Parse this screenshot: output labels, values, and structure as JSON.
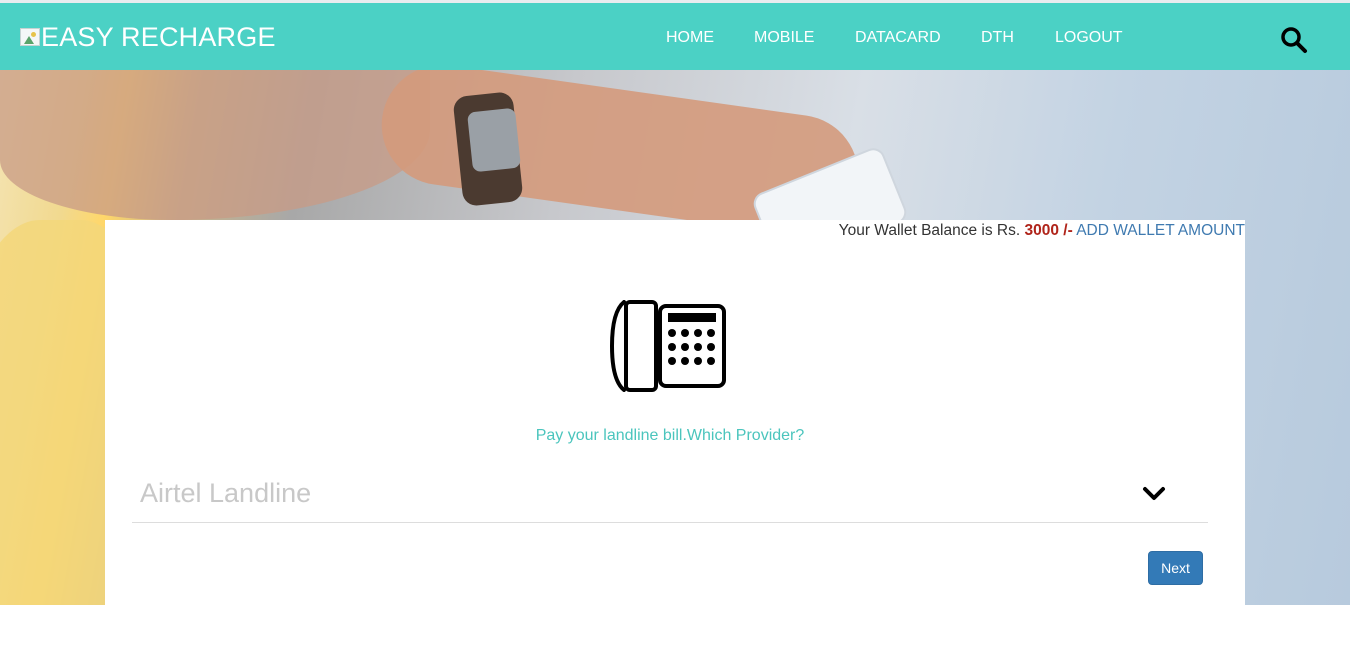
{
  "brand": {
    "name": "EASY RECHARGE"
  },
  "nav": {
    "items": [
      {
        "label": "HOME"
      },
      {
        "label": "MOBILE"
      },
      {
        "label": "DATACARD"
      },
      {
        "label": "DTH"
      },
      {
        "label": "LOGOUT"
      }
    ],
    "search_icon": "search-icon"
  },
  "wallet": {
    "prefix": "Your Wallet Balance is Rs.",
    "amount": "3000 /-",
    "add_link": "ADD WALLET AMOUNT"
  },
  "main": {
    "icon": "landline-phone-icon",
    "prompt": "Pay your landline bill.Which Provider?",
    "provider_select": {
      "selected": "Airtel Landline"
    },
    "next_button": "Next"
  },
  "colors": {
    "navbar": "#4bd1c5",
    "prompt": "#4bc5bd",
    "wallet_amount": "#b0241a",
    "link": "#3f7ab0",
    "button": "#337ab7"
  }
}
